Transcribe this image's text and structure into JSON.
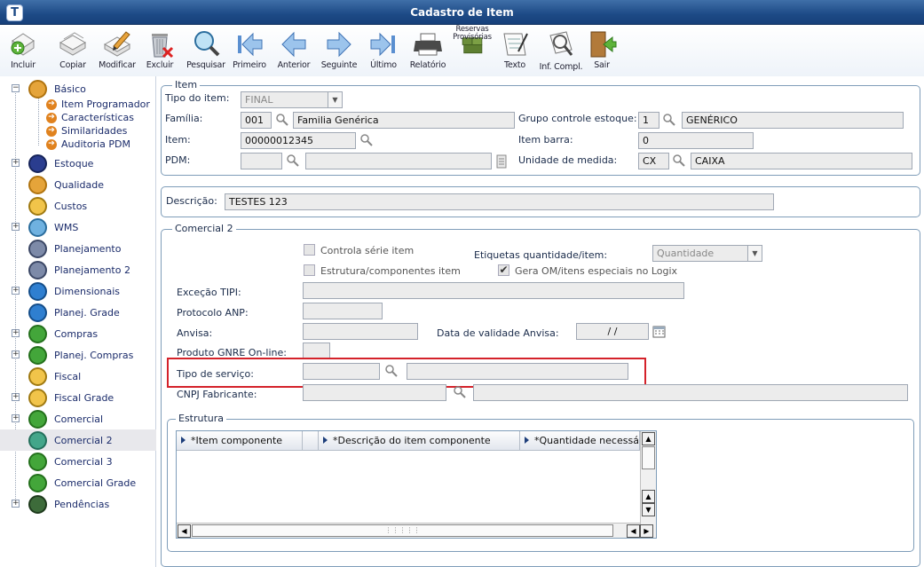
{
  "window": {
    "title": "Cadastro de Item",
    "app_icon": "T"
  },
  "toolbar": [
    {
      "id": "incluir",
      "label": "Incluir",
      "icon": "add-icon"
    },
    {
      "id": "copiar",
      "label": "Copiar",
      "icon": "copy-icon"
    },
    {
      "id": "modificar",
      "label": "Modificar",
      "icon": "edit-icon"
    },
    {
      "id": "excluir",
      "label": "Excluir",
      "icon": "delete-icon"
    },
    {
      "id": "pesquisar",
      "label": "Pesquisar",
      "icon": "search-icon"
    },
    {
      "id": "primeiro",
      "label": "Primeiro",
      "icon": "first-icon"
    },
    {
      "id": "anterior",
      "label": "Anterior",
      "icon": "previous-icon"
    },
    {
      "id": "seguinte",
      "label": "Seguinte",
      "icon": "next-icon"
    },
    {
      "id": "ultimo",
      "label": "Último",
      "icon": "last-icon"
    },
    {
      "id": "relatorio",
      "label": "Relatório",
      "icon": "printer-icon"
    },
    {
      "id": "reservas",
      "label": "Reservas Provisórias",
      "icon": "reserves-icon"
    },
    {
      "id": "texto",
      "label": "Texto",
      "icon": "text-icon"
    },
    {
      "id": "infcompl",
      "label": "Inf. Compl.",
      "icon": "info-icon"
    },
    {
      "id": "sair",
      "label": "Sair",
      "icon": "exit-icon"
    }
  ],
  "sidebar": {
    "basico": "Básico",
    "sub": [
      "Item Programador",
      "Características",
      "Similaridades",
      "Auditoria PDM"
    ],
    "items": [
      "Estoque",
      "Qualidade",
      "Custos",
      "WMS",
      "Planejamento",
      "Planejamento 2",
      "Dimensionais",
      "Planej. Grade",
      "Compras",
      "Planej. Compras",
      "Fiscal",
      "Fiscal Grade",
      "Comercial",
      "Comercial 2",
      "Comercial 3",
      "Comercial Grade",
      "Pendências"
    ],
    "selected": "Comercial 2"
  },
  "item": {
    "legend": "Item",
    "tipo_label": "Tipo do item:",
    "tipo_value": "FINAL",
    "familia_label": "Família:",
    "familia_code": "001",
    "familia_desc": "Familia Genérica",
    "item_label": "Item:",
    "item_value": "00000012345",
    "pdm_label": "PDM:",
    "grupo_label": "Grupo controle estoque:",
    "grupo_code": "1",
    "grupo_desc": "GENÉRICO",
    "barra_label": "Item barra:",
    "barra_value": "0",
    "unidade_label": "Unidade de medida:",
    "unidade_code": "CX",
    "unidade_desc": "CAIXA"
  },
  "descricao": {
    "label": "Descrição:",
    "value": "TESTES 123"
  },
  "comercial2": {
    "legend": "Comercial 2",
    "controla_serie": "Controla série item",
    "estrutura_comp": "Estrutura/componentes item",
    "etiquetas_label": "Etiquetas quantidade/item:",
    "etiquetas_value": "Quantidade",
    "gera_om": "Gera OM/itens especiais no Logix",
    "excecao_tipi": "Exceção TIPI:",
    "protocolo_anp": "Protocolo ANP:",
    "anvisa": "Anvisa:",
    "validade_anvisa": "Data de validade Anvisa:",
    "validade_value": "/ /",
    "gnre": "Produto GNRE On-line:",
    "tipo_servico": "Tipo de serviço:",
    "cnpj_fabricante": "CNPJ Fabricante:"
  },
  "estrutura": {
    "legend": "Estrutura",
    "columns": [
      "*Item componente",
      "*Descrição do item componente",
      "*Quantidade necessária"
    ]
  },
  "colors": {
    "title_bar": "#1d4a86",
    "highlight_box": "#d4222a",
    "selected_row": "#e8e8ec"
  }
}
